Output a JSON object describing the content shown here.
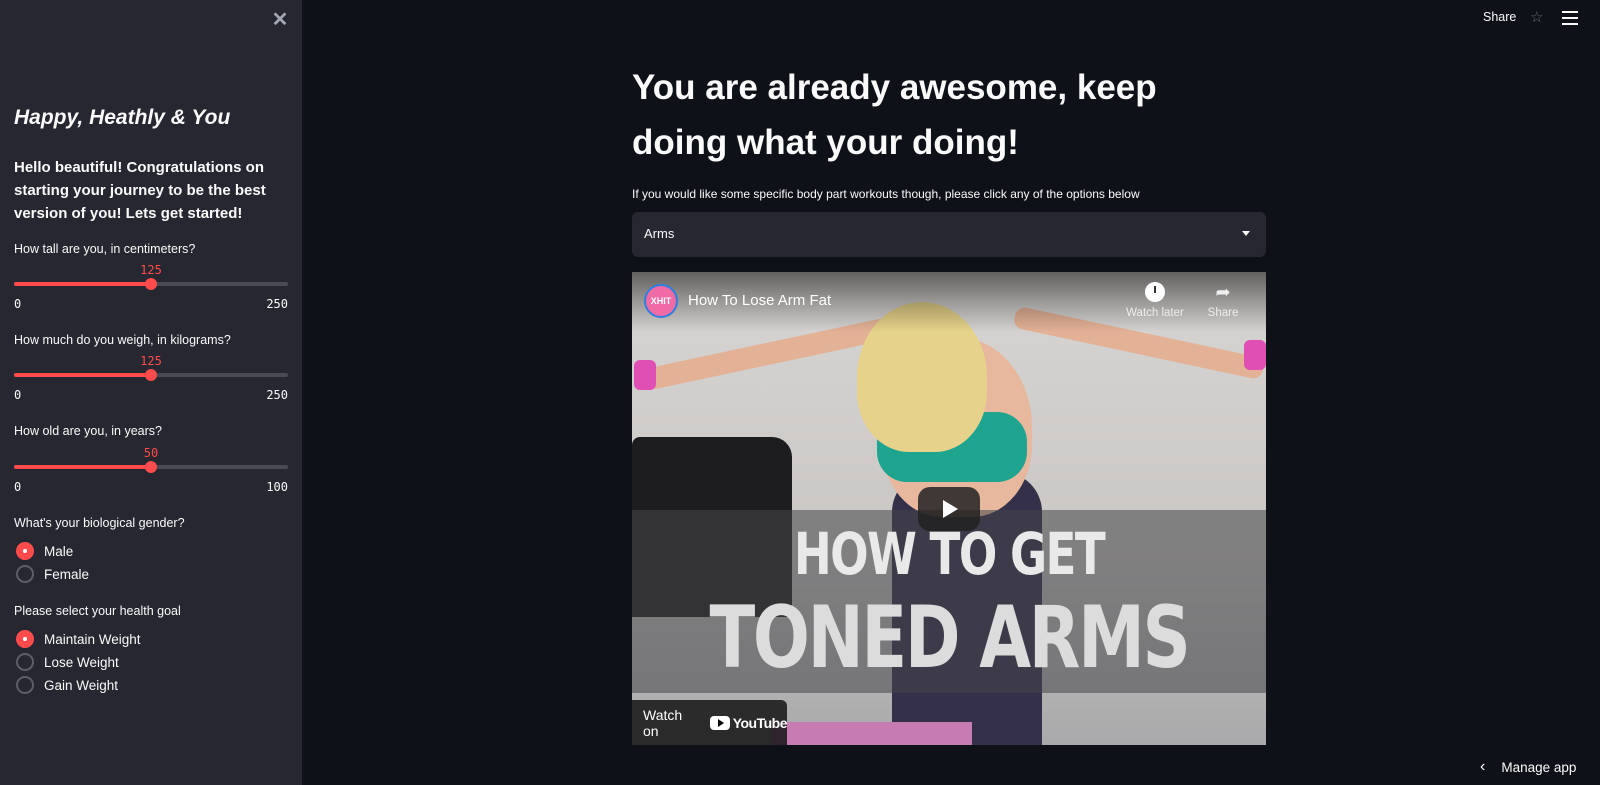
{
  "sidebar": {
    "close_icon": "close-icon",
    "title": "Happy, Heathly & You",
    "intro": "Hello beautiful! Congratulations on starting your journey to be the best version of you! Lets get started!",
    "sliders": [
      {
        "label": "How tall are you, in centimeters?",
        "value": "125",
        "min": "0",
        "max": "250",
        "fraction": 0.5
      },
      {
        "label": "How much do you weigh, in kilograms?",
        "value": "125",
        "min": "0",
        "max": "250",
        "fraction": 0.5
      },
      {
        "label": "How old are you, in years?",
        "value": "50",
        "min": "0",
        "max": "100",
        "fraction": 0.5
      }
    ],
    "gender": {
      "label": "What's your biological gender?",
      "options": [
        "Male",
        "Female"
      ],
      "selected": "Male"
    },
    "goal": {
      "label": "Please select your health goal",
      "options": [
        "Maintain Weight",
        "Lose Weight",
        "Gain Weight"
      ],
      "selected": "Maintain Weight"
    }
  },
  "topbar": {
    "share": "Share",
    "star_icon": "star-icon",
    "menu_icon": "hamburger-menu-icon"
  },
  "main": {
    "title": "You are already awesome, keep doing what your doing!",
    "subtitle": "If you would like some specific body part workouts though, please click any of the options below",
    "select_value": "Arms"
  },
  "video": {
    "channel_logo": "XHIT",
    "title": "How To Lose Arm Fat",
    "watch_later": "Watch later",
    "share": "Share",
    "overlay_line1": "HOW TO GET",
    "overlay_line2": "TONED ARMS",
    "watch_on": "Watch on",
    "youtube": "YouTube"
  },
  "footer": {
    "manage_app": "Manage app"
  },
  "colors": {
    "accent": "#ff4b4b",
    "background": "#0e1117",
    "sidebar": "#262730"
  }
}
